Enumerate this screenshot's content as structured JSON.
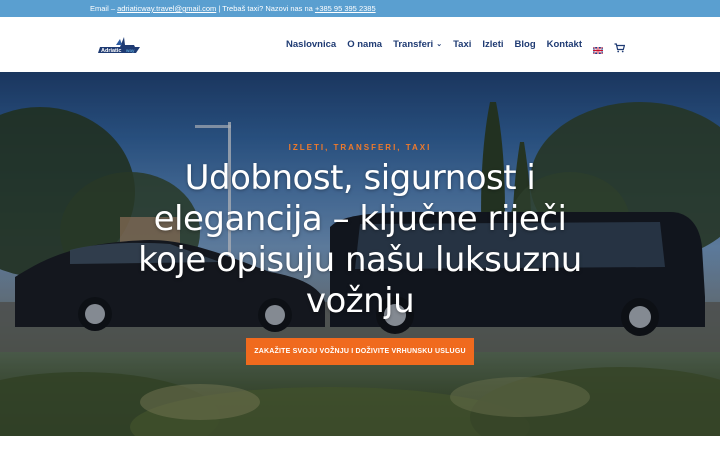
{
  "topbar": {
    "email_prefix": "Email – ",
    "email": "adriaticway.travel@gmail.com",
    "separator": " | ",
    "phone_prefix": "Trebaš taxi? Nazovi nas na ",
    "phone": "+385 95 395 2385"
  },
  "logo": {
    "text": "Adriatic",
    "subtext": "way"
  },
  "nav": {
    "items": [
      {
        "label": "Naslovnica"
      },
      {
        "label": "O nama"
      },
      {
        "label": "Transferi",
        "has_dropdown": true
      },
      {
        "label": "Taxi"
      },
      {
        "label": "Izleti"
      },
      {
        "label": "Blog"
      },
      {
        "label": "Kontakt"
      }
    ],
    "language_icon": "uk-flag-icon",
    "cart_icon": "cart-icon"
  },
  "hero": {
    "kicker": "IZLETI, TRANSFERI, TAXI",
    "headline": "Udobnost, sigurnost i elegancija – ključne riječi koje opisuju našu luksuznu vožnju",
    "cta_label": "ZAKAŽITE SVOJU VOŽNJU I DOŽIVITE VRHUNSKU USLUGU"
  },
  "colors": {
    "topbar_bg": "#5a9fd0",
    "nav_text": "#1f3b73",
    "accent": "#f06a1e",
    "kicker": "#f07a2a"
  }
}
